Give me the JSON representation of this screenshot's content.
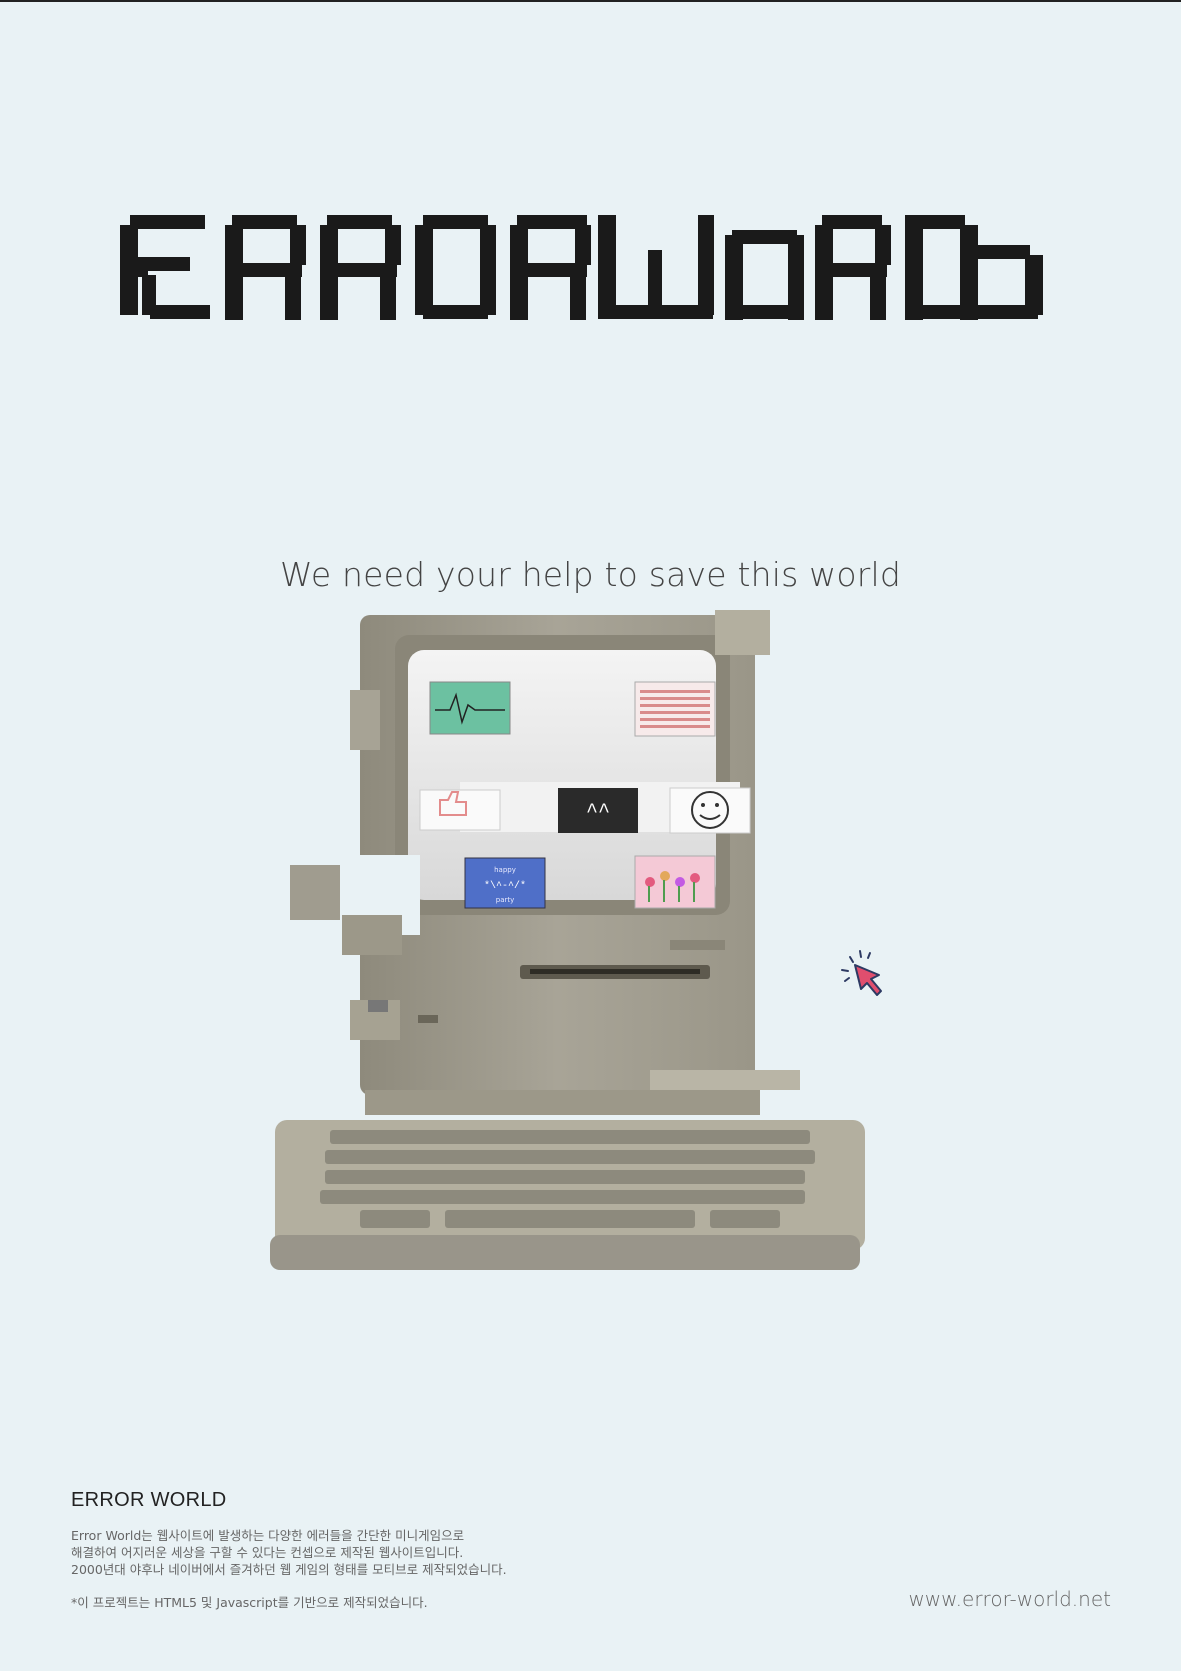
{
  "poster": {
    "title": "ERROR WORLD",
    "tagline": "We need your help to save this world"
  },
  "screen": {
    "windows": [
      {
        "name": "heartbeat-window"
      },
      {
        "name": "thank-you-window"
      },
      {
        "name": "thumbs-up-window"
      },
      {
        "name": "cute-face-window",
        "text": "^^"
      },
      {
        "name": "smiley-window"
      },
      {
        "name": "happy-party-window",
        "line1": "happy",
        "line2": "*\\^-^/*",
        "line3": "party"
      },
      {
        "name": "tulips-window"
      }
    ]
  },
  "footer": {
    "title": "ERROR WORLD",
    "description": [
      "Error World는 웹사이트에 발생하는 다양한 에러들을 간단한 미니게임으로",
      "해결하여 어지러운 세상을 구할 수 있다는 컨셉으로 제작된 웹사이트입니다.",
      "2000년대 야후나 네이버에서 즐겨하던 웹 게임의 형태를 모티브로 제작되었습니다."
    ],
    "note": "*이 프로젝트는 HTML5 및 Javascript를 기반으로 제작되었습니다.",
    "url": "www.error-world.net"
  },
  "colors": {
    "background": "#e9f2f5",
    "logo": "#1a1a1a",
    "computer": "#a9a597",
    "cursor": "#e04e6e"
  },
  "icons": [
    "pixel-logo",
    "retro-computer-illustration",
    "click-cursor-icon"
  ]
}
